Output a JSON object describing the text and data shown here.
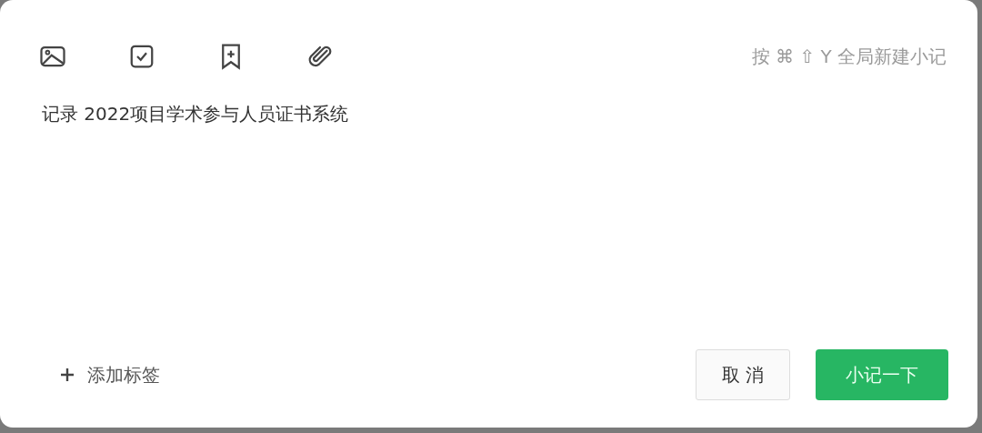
{
  "toolbar": {
    "tools": [
      {
        "kind": "image"
      },
      {
        "kind": "checkbox"
      },
      {
        "kind": "bookmark"
      },
      {
        "kind": "attachment"
      }
    ],
    "shortcut_hint": "按 ⌘ ⇧ Y 全局新建小记"
  },
  "editor": {
    "value": "记录 2022项目学术参与人员证书系统"
  },
  "footer": {
    "add_tag": "添加标签",
    "cancel": "取 消",
    "submit": "小记一下"
  }
}
